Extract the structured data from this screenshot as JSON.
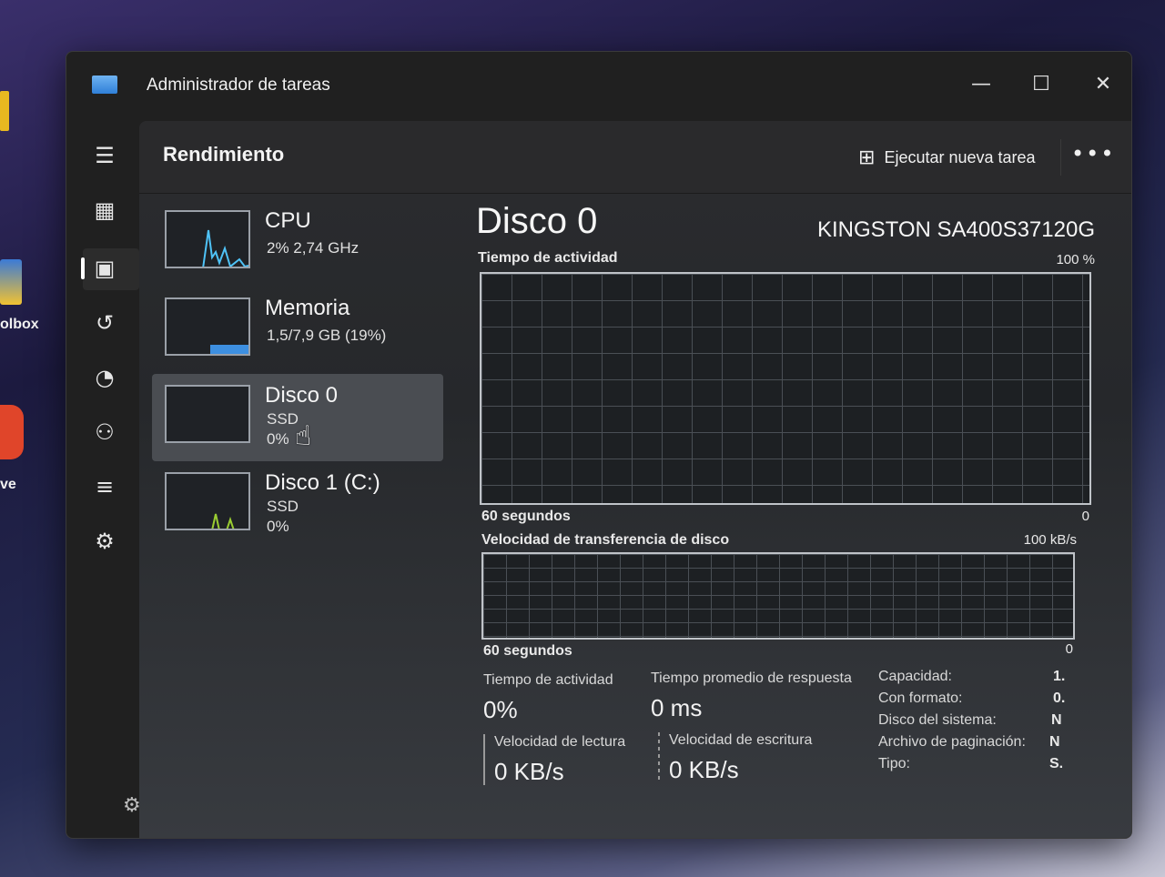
{
  "desktop": {
    "label_1": "olbox",
    "label_2": "ve"
  },
  "window": {
    "title": "Administrador de tareas",
    "controls": {
      "minimize": "—",
      "maximize": "☐",
      "close": "✕"
    }
  },
  "header": {
    "title": "Rendimiento",
    "run_task_label": "Ejecutar nueva tarea",
    "more": "•••"
  },
  "sidebar": {
    "items": [
      {
        "name": "menu-icon",
        "glyph": "☰"
      },
      {
        "name": "processes-icon",
        "glyph": "▦"
      },
      {
        "name": "performance-icon",
        "glyph": "▣"
      },
      {
        "name": "app-history-icon",
        "glyph": "↺"
      },
      {
        "name": "startup-apps-icon",
        "glyph": "◔"
      },
      {
        "name": "users-icon",
        "glyph": "⚇"
      },
      {
        "name": "details-icon",
        "glyph": "≡"
      },
      {
        "name": "services-icon",
        "glyph": "⚙"
      }
    ],
    "settings_glyph": "⚙"
  },
  "perf_list": [
    {
      "name": "CPU",
      "line1": "2% 2,74 GHz",
      "line2": "",
      "selected": false,
      "graph_color": "#4fc3f7"
    },
    {
      "name": "Memoria",
      "line1": "1,5/7,9 GB (19%)",
      "line2": "",
      "selected": false,
      "graph_color": "#3d8fe0"
    },
    {
      "name": "Disco 0",
      "line1": "SSD",
      "line2": "0%",
      "selected": true,
      "graph_color": "#9acd32"
    },
    {
      "name": "Disco 1 (C:)",
      "line1": "SSD",
      "line2": "0%",
      "selected": false,
      "graph_color": "#9acd32"
    }
  ],
  "detail": {
    "title": "Disco 0",
    "model": "KINGSTON SA400S37120G",
    "graph1": {
      "label": "Tiempo de actividad",
      "max": "100 %",
      "time": "60 segundos",
      "min": "0"
    },
    "graph2": {
      "label": "Velocidad de transferencia de disco",
      "max": "100 kB/s",
      "time": "60 segundos",
      "min": "0"
    },
    "stats": {
      "active_time_label": "Tiempo de actividad",
      "active_time_value": "0%",
      "response_label": "Tiempo promedio de respuesta",
      "response_value": "0 ms",
      "read_label": "Velocidad de lectura",
      "read_value": "0 KB/s",
      "write_label": "Velocidad de escritura",
      "write_value": "0 KB/s"
    },
    "properties": [
      {
        "key": "Capacidad:",
        "value": "1."
      },
      {
        "key": "Con formato:",
        "value": "0."
      },
      {
        "key": "Disco del sistema:",
        "value": "N"
      },
      {
        "key": "Archivo de paginación:",
        "value": "N"
      },
      {
        "key": "Tipo:",
        "value": "S."
      }
    ]
  }
}
